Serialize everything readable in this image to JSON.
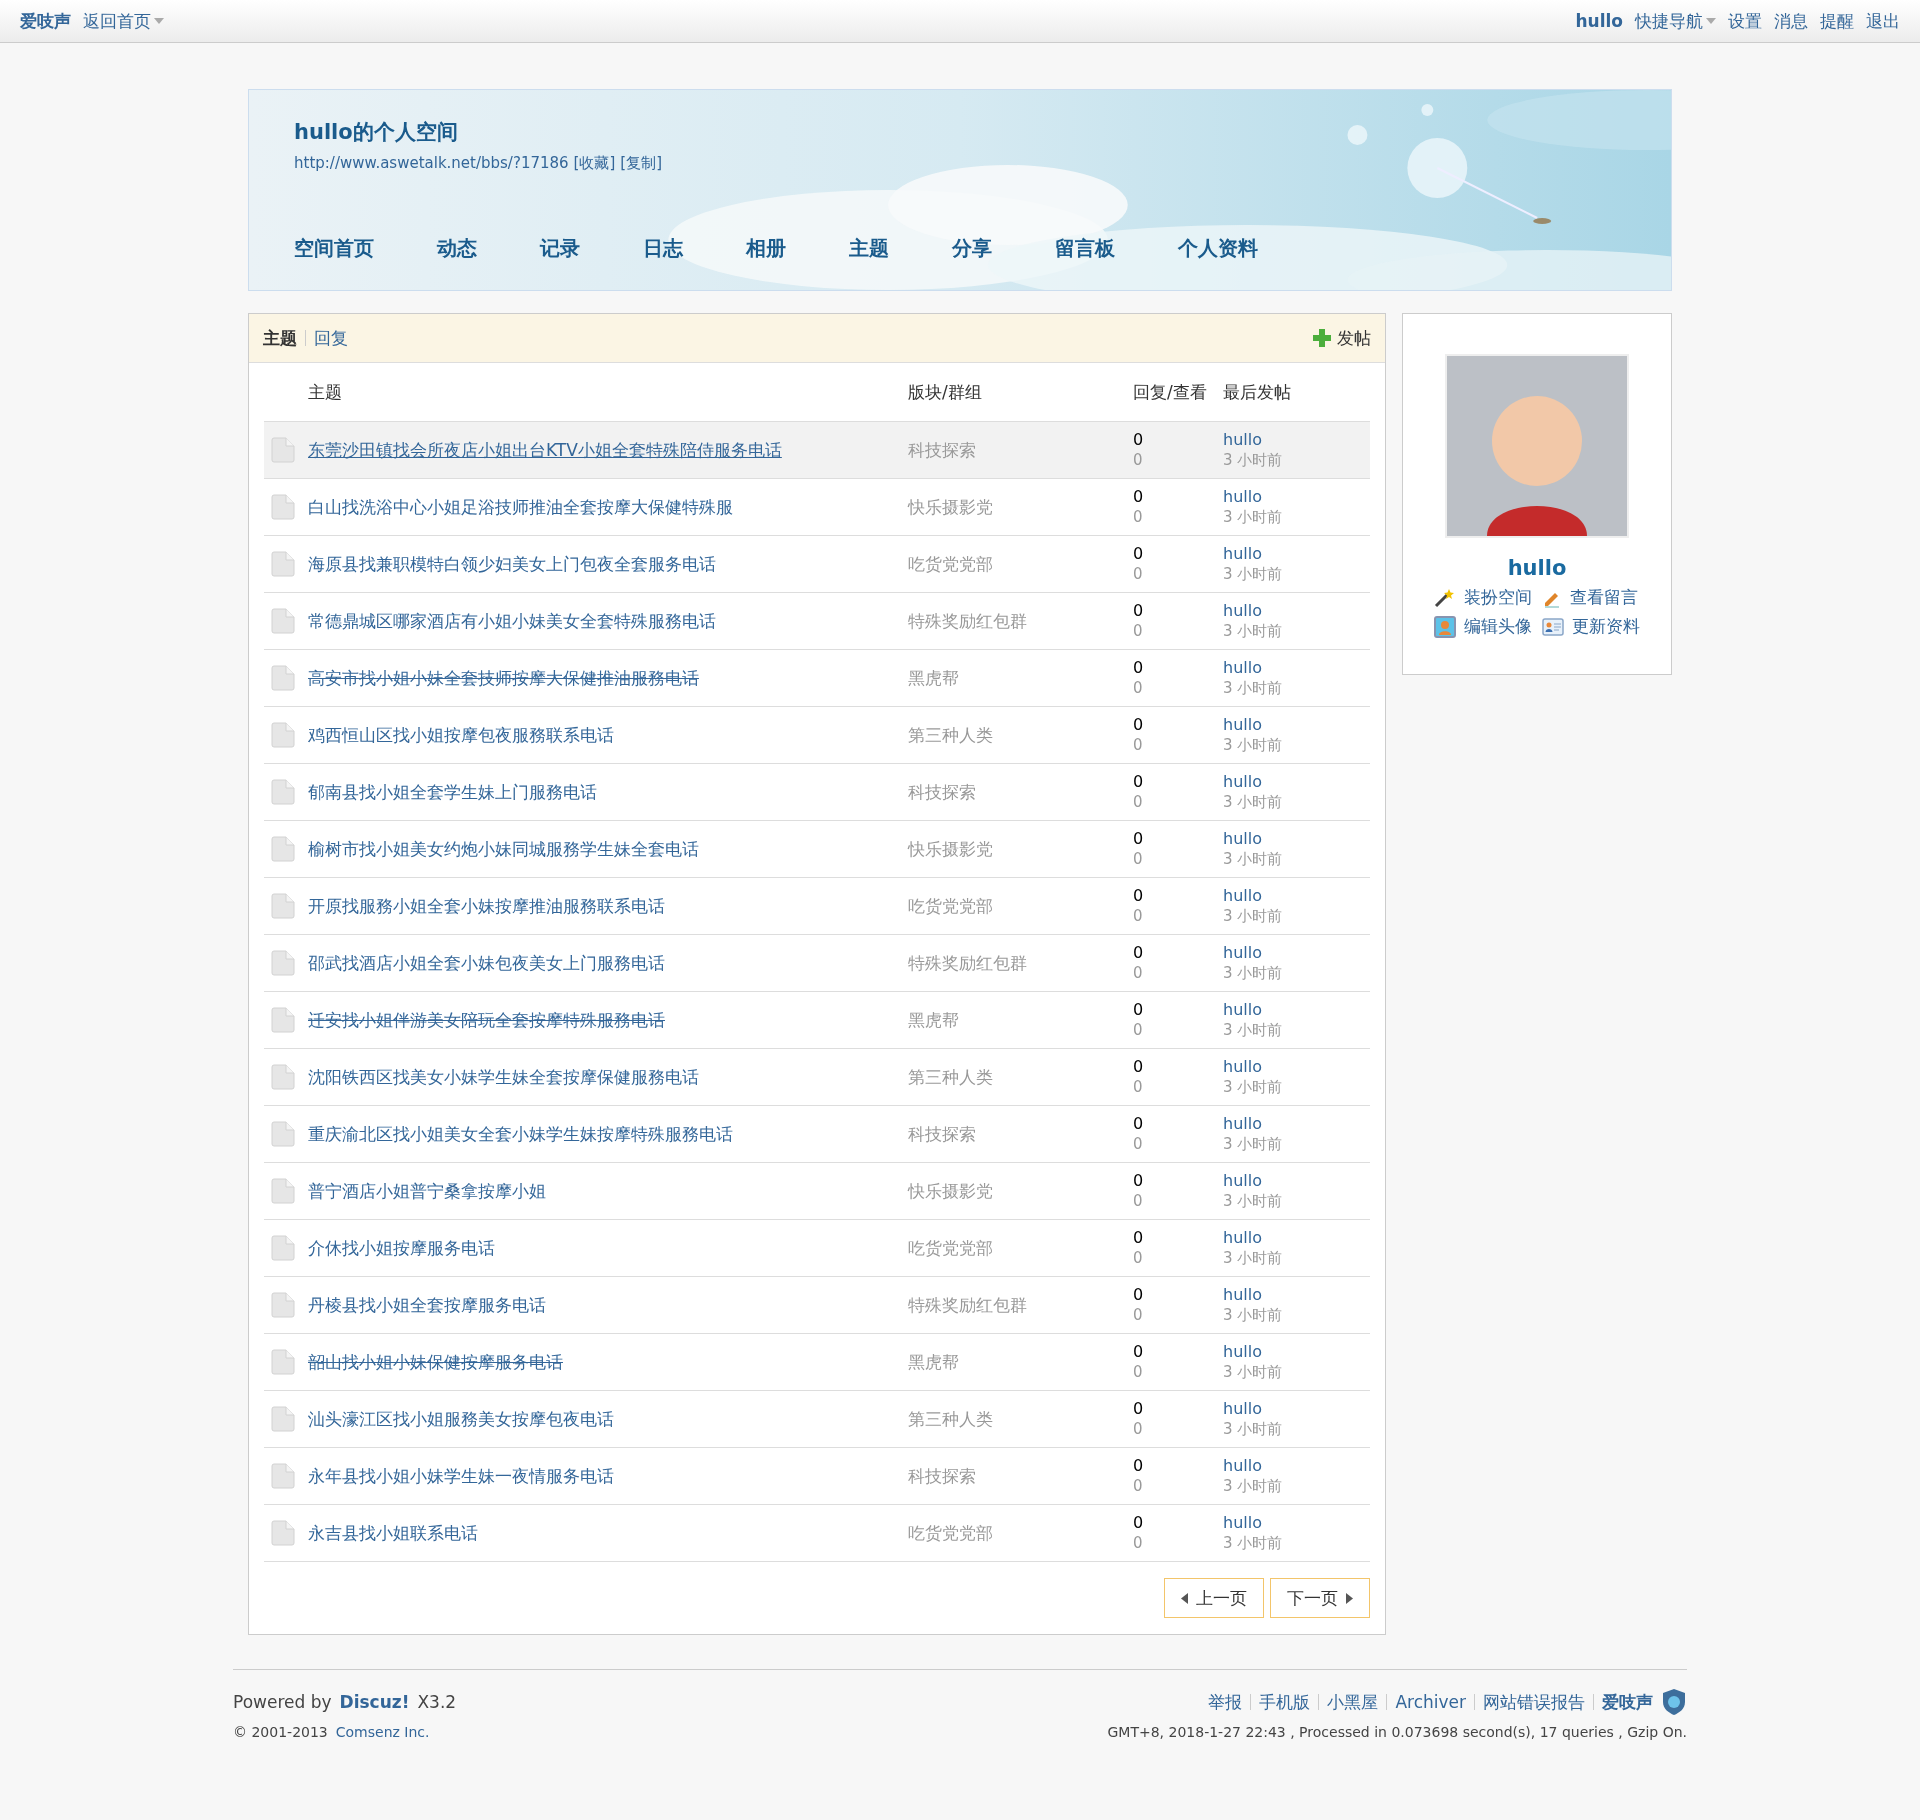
{
  "top_bar": {
    "site_name": "爱吱声",
    "home_link": "返回首页",
    "username": "hullo",
    "quick_nav": "快捷导航",
    "links": [
      "设置",
      "消息",
      "提醒",
      "退出"
    ]
  },
  "space": {
    "title": "hullo的个人空间",
    "url": "http://www.aswetalk.net/bbs/?17186",
    "actions": [
      "[收藏]",
      "[复制]"
    ],
    "nav": [
      "空间首页",
      "动态",
      "记录",
      "日志",
      "相册",
      "主题",
      "分享",
      "留言板",
      "个人资料"
    ]
  },
  "threads": {
    "tabs": [
      {
        "label": "主题",
        "selected": true
      },
      {
        "label": "回复",
        "selected": false
      }
    ],
    "post_button": "发帖",
    "columns": [
      "主题",
      "版块/群组",
      "回复/查看",
      "最后发帖"
    ],
    "rows": [
      {
        "title": "东莞沙田镇找会所夜店小姐出台KTV小姐全套特殊陪侍服务电话",
        "forum": "科技探索",
        "replies": "0",
        "views": "0",
        "author": "hullo",
        "time": "3 小时前",
        "hovered": true,
        "struck": false
      },
      {
        "title": "白山找洗浴中心小姐足浴技师推油全套按摩大保健特殊服",
        "forum": "快乐摄影党",
        "replies": "0",
        "views": "0",
        "author": "hullo",
        "time": "3 小时前",
        "hovered": false,
        "struck": false
      },
      {
        "title": "海原县找兼职模特白领少妇美女上门包夜全套服务电话",
        "forum": "吃货党党部",
        "replies": "0",
        "views": "0",
        "author": "hullo",
        "time": "3 小时前",
        "hovered": false,
        "struck": false
      },
      {
        "title": "常德鼎城区哪家酒店有小姐小妹美女全套特殊服務电话",
        "forum": "特殊奖励红包群",
        "replies": "0",
        "views": "0",
        "author": "hullo",
        "time": "3 小时前",
        "hovered": false,
        "struck": false
      },
      {
        "title": "高安市找小姐小妹全套技师按摩大保健推油服務电话",
        "forum": "黑虎帮",
        "replies": "0",
        "views": "0",
        "author": "hullo",
        "time": "3 小时前",
        "hovered": false,
        "struck": true
      },
      {
        "title": "鸡西恒山区找小姐按摩包夜服務联系电话",
        "forum": "第三种人类",
        "replies": "0",
        "views": "0",
        "author": "hullo",
        "time": "3 小时前",
        "hovered": false,
        "struck": false
      },
      {
        "title": "郁南县找小姐全套学生妹上门服務电话",
        "forum": "科技探索",
        "replies": "0",
        "views": "0",
        "author": "hullo",
        "time": "3 小时前",
        "hovered": false,
        "struck": false
      },
      {
        "title": "榆树市找小姐美女约炮小妹同城服務学生妹全套电话",
        "forum": "快乐摄影党",
        "replies": "0",
        "views": "0",
        "author": "hullo",
        "time": "3 小时前",
        "hovered": false,
        "struck": false
      },
      {
        "title": "开原找服務小姐全套小妹按摩推油服務联系电话",
        "forum": "吃货党党部",
        "replies": "0",
        "views": "0",
        "author": "hullo",
        "time": "3 小时前",
        "hovered": false,
        "struck": false
      },
      {
        "title": "邵武找酒店小姐全套小妹包夜美女上门服務电话",
        "forum": "特殊奖励红包群",
        "replies": "0",
        "views": "0",
        "author": "hullo",
        "time": "3 小时前",
        "hovered": false,
        "struck": false
      },
      {
        "title": "迁安找小姐伴游美女陪玩全套按摩特殊服務电话",
        "forum": "黑虎帮",
        "replies": "0",
        "views": "0",
        "author": "hullo",
        "time": "3 小时前",
        "hovered": false,
        "struck": true
      },
      {
        "title": "沈阳铁西区找美女小妹学生妹全套按摩保健服務电话",
        "forum": "第三种人类",
        "replies": "0",
        "views": "0",
        "author": "hullo",
        "time": "3 小时前",
        "hovered": false,
        "struck": false
      },
      {
        "title": "重庆渝北区找小姐美女全套小妹学生妹按摩特殊服務电话",
        "forum": "科技探索",
        "replies": "0",
        "views": "0",
        "author": "hullo",
        "time": "3 小时前",
        "hovered": false,
        "struck": false
      },
      {
        "title": "普宁酒店小姐普宁桑拿按摩小姐",
        "forum": "快乐摄影党",
        "replies": "0",
        "views": "0",
        "author": "hullo",
        "time": "3 小时前",
        "hovered": false,
        "struck": false
      },
      {
        "title": "介休找小姐按摩服务电话",
        "forum": "吃货党党部",
        "replies": "0",
        "views": "0",
        "author": "hullo",
        "time": "3 小时前",
        "hovered": false,
        "struck": false
      },
      {
        "title": "丹棱县找小姐全套按摩服务电话",
        "forum": "特殊奖励红包群",
        "replies": "0",
        "views": "0",
        "author": "hullo",
        "time": "3 小时前",
        "hovered": false,
        "struck": false
      },
      {
        "title": "韶山找小姐小妹保健按摩服务电话",
        "forum": "黑虎帮",
        "replies": "0",
        "views": "0",
        "author": "hullo",
        "time": "3 小时前",
        "hovered": false,
        "struck": true
      },
      {
        "title": "汕头濠江区找小姐服務美女按摩包夜电话",
        "forum": "第三种人类",
        "replies": "0",
        "views": "0",
        "author": "hullo",
        "time": "3 小时前",
        "hovered": false,
        "struck": false
      },
      {
        "title": "永年县找小姐小妹学生妹一夜情服务电话",
        "forum": "科技探索",
        "replies": "0",
        "views": "0",
        "author": "hullo",
        "time": "3 小时前",
        "hovered": false,
        "struck": false
      },
      {
        "title": "永吉县找小姐联系电话",
        "forum": "吃货党党部",
        "replies": "0",
        "views": "0",
        "author": "hullo",
        "time": "3 小时前",
        "hovered": false,
        "struck": false
      }
    ],
    "pagination": {
      "prev": "上一页",
      "next": "下一页"
    }
  },
  "profile": {
    "name": "hullo",
    "links": [
      {
        "label": "装扮空间",
        "kind": "wand"
      },
      {
        "label": "查看留言",
        "kind": "pencil"
      },
      {
        "label": "编辑头像",
        "kind": "portrait"
      },
      {
        "label": "更新资料",
        "kind": "card"
      }
    ]
  },
  "footer": {
    "powered_by": "Powered by",
    "product": "Discuz!",
    "version": "X3.2",
    "copyright": "© 2001-2013",
    "company": "Comsenz Inc.",
    "links": [
      "举报",
      "手机版",
      "小黑屋",
      "Archiver",
      "网站错误报告"
    ],
    "site_name": "爱吱声",
    "stats": "GMT+8, 2018-1-27 22:43 , Processed in 0.073698 second(s), 17 queries , Gzip On."
  }
}
